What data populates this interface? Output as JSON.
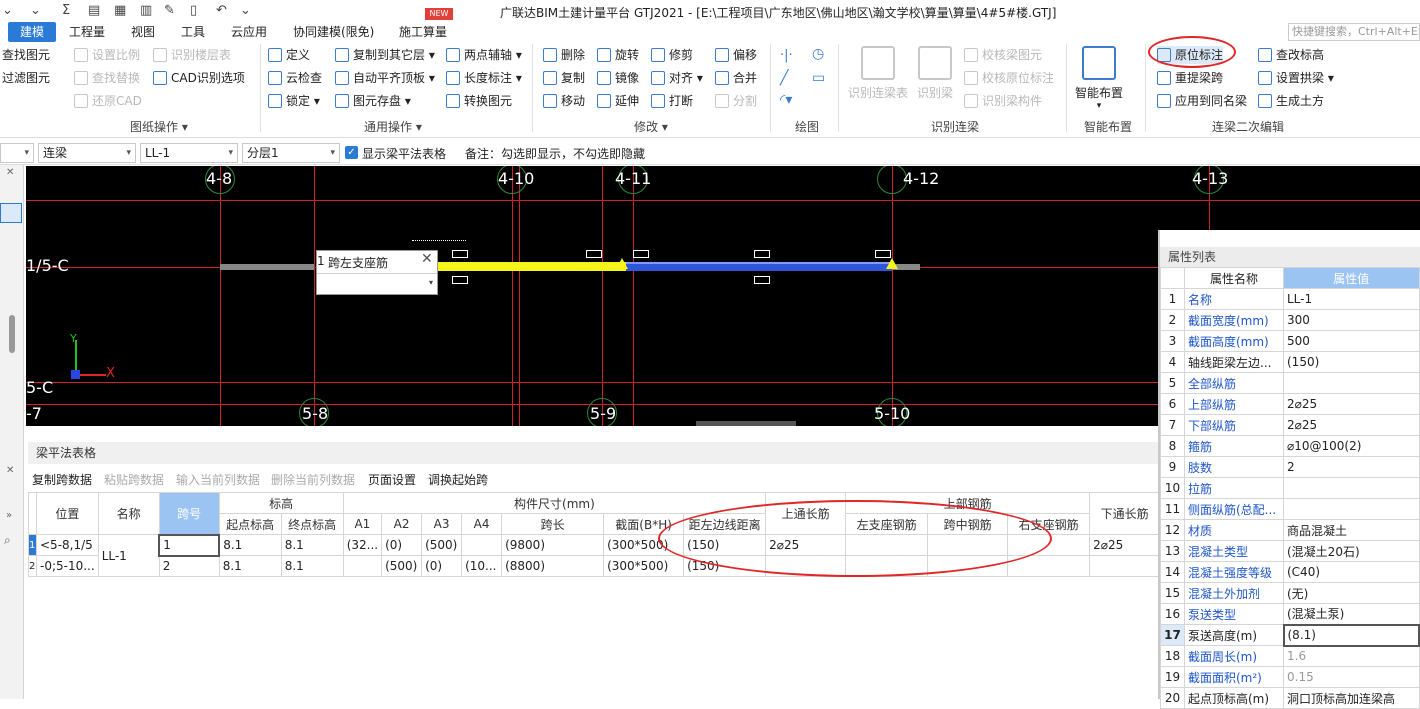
{
  "title_bar": {
    "title": "广联达BIM土建计量平台 GTJ2021 - [E:\\工程项目\\广东地区\\佛山地区\\瀚文学校\\算量\\算量\\4#5#楼.GTJ]"
  },
  "menu": {
    "tabs": [
      "建模",
      "工程量",
      "视图",
      "工具",
      "云应用",
      "协同建模(限免)",
      "施工算量"
    ],
    "new_badge": "NEW",
    "search_placeholder": "快捷键搜索，Ctrl+Alt+Enter"
  },
  "ribbon": {
    "drawing_ops": {
      "items": [
        "查找图元",
        "过滤图元",
        "设置比例",
        "查找替换",
        "还原CAD",
        "识别楼层表",
        "CAD识别选项"
      ],
      "group_label": "图纸操作"
    },
    "common_ops": {
      "items": [
        "定义",
        "云检查",
        "锁定",
        "复制到其它层",
        "自动平齐顶板",
        "图元存盘",
        "两点辅轴",
        "长度标注",
        "转换图元"
      ],
      "group_label": "通用操作"
    },
    "modify": {
      "items": [
        "删除",
        "复制",
        "移动",
        "旋转",
        "镜像",
        "延伸",
        "修剪",
        "对齐",
        "打断",
        "偏移",
        "合并",
        "分割"
      ],
      "group_label": "修改"
    },
    "draw": {
      "group_label": "绘图"
    },
    "identify_beam": {
      "big": [
        "识别连梁表",
        "识别梁"
      ],
      "items": [
        "校核梁图元",
        "校核原位标注",
        "识别梁构件"
      ],
      "group_label": "识别连梁"
    },
    "smart": {
      "big": "智能布置",
      "group_label": "智能布置"
    },
    "beam_edit": {
      "items": [
        "原位标注",
        "重提梁跨",
        "应用到同名梁",
        "查改标高",
        "设置拱梁",
        "生成土方"
      ],
      "group_label": "连梁二次编辑"
    }
  },
  "toolbar": {
    "type_select": "连梁",
    "name_select": "LL-1",
    "floor_select": "分层1",
    "checkbox_label": "显示梁平法表格",
    "note": "备注：勾选即显示，不勾选即隐藏"
  },
  "canvas": {
    "top_axes": [
      "4-8",
      "4-10",
      "4-11",
      "4-12",
      "4-13"
    ],
    "bottom_axes": [
      "5-8",
      "5-9",
      "5-10"
    ],
    "left_axes": [
      "1/5-C",
      "5-C",
      "-7"
    ],
    "popup_title": "跨左支座筋",
    "popup_index": "1"
  },
  "beam_table": {
    "title": "梁平法表格",
    "buttons": [
      "复制跨数据",
      "粘贴跨数据",
      "输入当前列数据",
      "删除当前列数据",
      "页面设置",
      "调换起始跨"
    ],
    "header_top": {
      "position": "位置",
      "name": "名称",
      "span": "跨号",
      "elevation": "标高",
      "size": "构件尺寸(mm)",
      "top_through": "上通长筋",
      "top_bars": "上部钢筋",
      "bottom_through": "下通长筋"
    },
    "header_sub": [
      "起点标高",
      "终点标高",
      "A1",
      "A2",
      "A3",
      "A4",
      "跨长",
      "截面(B*H)",
      "距左边线距离",
      "左支座钢筋",
      "跨中钢筋",
      "右支座钢筋"
    ],
    "rows": [
      {
        "rownum": "1",
        "position": "<5-8,1/5",
        "name": "LL-1",
        "span": "1",
        "start": "8.1",
        "end": "8.1",
        "a1": "(32...",
        "a2": "(0)",
        "a3": "(500)",
        "a4": "",
        "length": "(9800)",
        "section": "(300*500)",
        "dist": "(150)",
        "top_through": "2⌀25",
        "left": "",
        "mid": "",
        "right": "",
        "bottom_through": "2⌀25"
      },
      {
        "rownum": "2",
        "position": "-0;5-10...",
        "name": "",
        "span": "2",
        "start": "8.1",
        "end": "8.1",
        "a1": "",
        "a2": "(500)",
        "a3": "(0)",
        "a4": "(10...",
        "length": "(8800)",
        "section": "(300*500)",
        "dist": "(150)",
        "top_through": "",
        "left": "",
        "mid": "",
        "right": "",
        "bottom_through": ""
      }
    ]
  },
  "properties": {
    "title": "属性列表",
    "col_name": "属性名称",
    "col_value": "属性值",
    "rows": [
      {
        "n": "1",
        "name": "名称",
        "value": "LL-1",
        "blue": true
      },
      {
        "n": "2",
        "name": "截面宽度(mm)",
        "value": "300",
        "blue": true
      },
      {
        "n": "3",
        "name": "截面高度(mm)",
        "value": "500",
        "blue": true
      },
      {
        "n": "4",
        "name": "轴线距梁左边...",
        "value": "(150)",
        "blue": false
      },
      {
        "n": "5",
        "name": "全部纵筋",
        "value": "",
        "blue": true
      },
      {
        "n": "6",
        "name": "上部纵筋",
        "value": "2⌀25",
        "blue": true
      },
      {
        "n": "7",
        "name": "下部纵筋",
        "value": "2⌀25",
        "blue": true
      },
      {
        "n": "8",
        "name": "箍筋",
        "value": "⌀10@100(2)",
        "blue": true
      },
      {
        "n": "9",
        "name": "肢数",
        "value": "2",
        "blue": true
      },
      {
        "n": "10",
        "name": "拉筋",
        "value": "",
        "blue": true
      },
      {
        "n": "11",
        "name": "侧面纵筋(总配...",
        "value": "",
        "blue": true
      },
      {
        "n": "12",
        "name": "材质",
        "value": "商品混凝土",
        "blue": true
      },
      {
        "n": "13",
        "name": "混凝土类型",
        "value": "(混凝土20石)",
        "blue": true
      },
      {
        "n": "14",
        "name": "混凝土强度等级",
        "value": "(C40)",
        "blue": true
      },
      {
        "n": "15",
        "name": "混凝土外加剂",
        "value": "(无)",
        "blue": true
      },
      {
        "n": "16",
        "name": "泵送类型",
        "value": "(混凝土泵)",
        "blue": true
      },
      {
        "n": "17",
        "name": "泵送高度(m)",
        "value": "(8.1)",
        "blue": false
      },
      {
        "n": "18",
        "name": "截面周长(m)",
        "value": "1.6",
        "blue": true
      },
      {
        "n": "19",
        "name": "截面面积(m²)",
        "value": "0.15",
        "blue": true
      },
      {
        "n": "20",
        "name": "起点顶标高(m)",
        "value": "洞口顶标高加连梁高",
        "blue": false
      }
    ]
  },
  "colors": {
    "accent": "#2b7ad6",
    "grid_line": "#d0202a",
    "beam_yellow": "#f5f51a",
    "beam_blue": "#2f55d8",
    "annotation_red": "#e02626"
  }
}
